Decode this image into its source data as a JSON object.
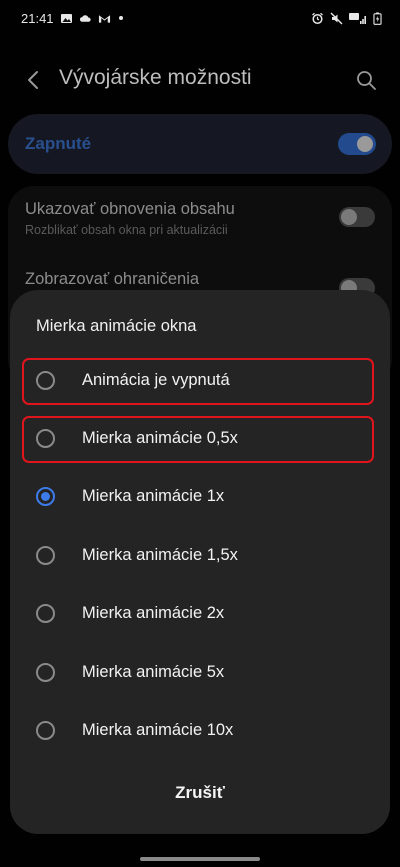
{
  "status": {
    "time": "21:41"
  },
  "header": {
    "title": "Vývojárske možnosti"
  },
  "master": {
    "label": "Zapnuté",
    "on": true
  },
  "settings": [
    {
      "title": "Ukazovať obnovenia obsahu",
      "subtitle": "Rozblikať obsah okna pri aktualizácii",
      "on": false
    },
    {
      "title": "Zobrazovať ohraničenia",
      "subtitle": "",
      "on": false
    }
  ],
  "dialog": {
    "title": "Mierka animácie okna",
    "options": [
      {
        "label": "Animácia je vypnutá",
        "selected": false,
        "highlighted": true
      },
      {
        "label": "Mierka animácie 0,5x",
        "selected": false,
        "highlighted": true
      },
      {
        "label": "Mierka animácie 1x",
        "selected": true,
        "highlighted": false
      },
      {
        "label": "Mierka animácie 1,5x",
        "selected": false,
        "highlighted": false
      },
      {
        "label": "Mierka animácie 2x",
        "selected": false,
        "highlighted": false
      },
      {
        "label": "Mierka animácie 5x",
        "selected": false,
        "highlighted": false
      },
      {
        "label": "Mierka animácie 10x",
        "selected": false,
        "highlighted": false
      }
    ],
    "cancel_label": "Zrušiť"
  },
  "colors": {
    "accent": "#3e7bea",
    "highlight": "#e0141c",
    "dialog_bg": "#242424"
  }
}
